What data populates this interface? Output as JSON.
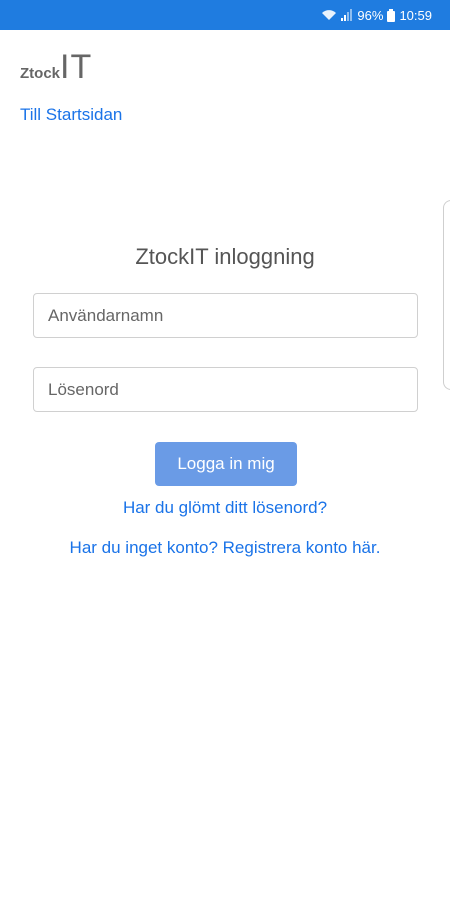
{
  "status_bar": {
    "battery": "96%",
    "time": "10:59",
    "icons": [
      "wifi-icon",
      "signal-icon",
      "battery-icon"
    ]
  },
  "header": {
    "logo_small": "Ztock",
    "logo_big": "IT",
    "home_link": "Till Startsidan"
  },
  "login": {
    "title": "ZtockIT inloggning",
    "username_placeholder": "Användarnamn",
    "password_placeholder": "Lösenord",
    "submit_label": "Logga in mig",
    "forgot_link": "Har du glömt ditt lösenord?",
    "register_link": "Har du inget konto? Registrera konto här."
  },
  "colors": {
    "status_bar": "#1f7ce0",
    "link": "#1a73e8",
    "button": "#6a9be6"
  }
}
